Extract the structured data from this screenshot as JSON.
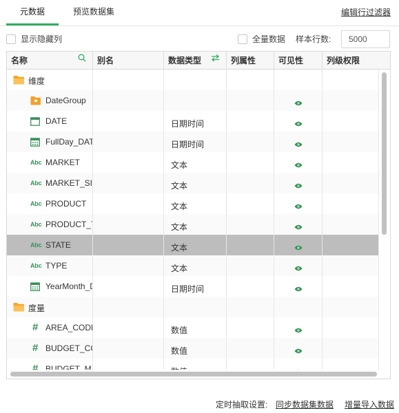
{
  "tabs": [
    {
      "label": "元数据",
      "active": true
    },
    {
      "label": "预览数据集",
      "active": false
    }
  ],
  "edit_filter_label": "编辑行过滤器",
  "options": {
    "show_hidden_label": "显示隐藏列",
    "show_hidden_checked": false,
    "full_data_label": "全量数据",
    "full_data_checked": false,
    "sample_rows_label": "样本行数:",
    "sample_rows_value": "5000"
  },
  "columns": [
    "名称",
    "别名",
    "数据类型",
    "列属性",
    "可见性",
    "列级权限"
  ],
  "rows": [
    {
      "kind": "group",
      "icon": "folder-icon",
      "name": "维度",
      "type": "",
      "visible": false
    },
    {
      "kind": "field",
      "icon": "folder-small-icon",
      "name": "DateGroup",
      "type": "",
      "visible": true
    },
    {
      "kind": "field",
      "icon": "calendar-icon",
      "name": "DATE",
      "type": "日期时间",
      "visible": true
    },
    {
      "kind": "field",
      "icon": "calendar-grid-icon",
      "name": "FullDay_DAT",
      "type": "日期时间",
      "visible": true
    },
    {
      "kind": "field",
      "icon": "abc-icon",
      "name": "MARKET",
      "type": "文本",
      "visible": true
    },
    {
      "kind": "field",
      "icon": "abc-icon",
      "name": "MARKET_SI",
      "type": "文本",
      "visible": true
    },
    {
      "kind": "field",
      "icon": "abc-icon",
      "name": "PRODUCT",
      "type": "文本",
      "visible": true
    },
    {
      "kind": "field",
      "icon": "abc-icon",
      "name": "PRODUCT_T",
      "type": "文本",
      "visible": true
    },
    {
      "kind": "field",
      "icon": "abc-icon",
      "name": "STATE",
      "type": "文本",
      "visible": true,
      "selected": true
    },
    {
      "kind": "field",
      "icon": "abc-icon",
      "name": "TYPE",
      "type": "文本",
      "visible": true
    },
    {
      "kind": "field",
      "icon": "calendar-grid-icon",
      "name": "YearMonth_D",
      "type": "日期时间",
      "visible": true
    },
    {
      "kind": "group",
      "icon": "folder-icon",
      "name": "度量",
      "type": "",
      "visible": false
    },
    {
      "kind": "field",
      "icon": "hash-icon",
      "name": "AREA_CODE",
      "type": "数值",
      "visible": true
    },
    {
      "kind": "field",
      "icon": "hash-icon",
      "name": "BUDGET_CC",
      "type": "数值",
      "visible": true
    },
    {
      "kind": "field",
      "icon": "hash-icon",
      "name": "BUDGET_MA",
      "type": "数值",
      "visible": true
    }
  ],
  "footer": {
    "schedule_label": "定时抽取设置:",
    "sync_label": "同步数据集数据",
    "incremental_label": "增量导入数据"
  },
  "colors": {
    "accent": "#2fae5f",
    "selected_row": "#bdbdbd",
    "icon_green": "#3a8f5a",
    "folder": "#f6a623"
  }
}
